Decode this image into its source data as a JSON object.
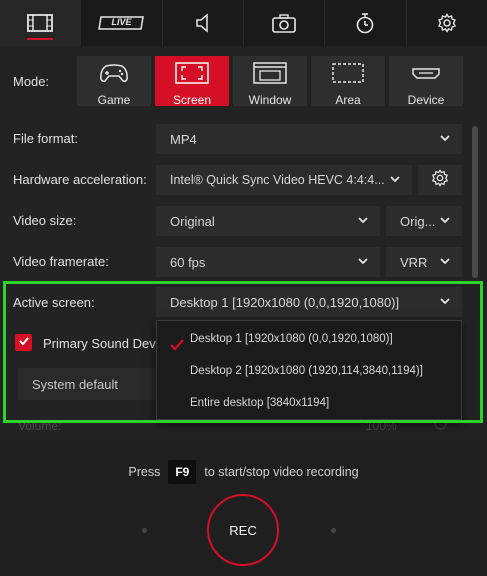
{
  "top_tabs": [
    {
      "icon": "film-icon",
      "active": true
    },
    {
      "icon": "live-icon",
      "label": "LIVE",
      "active": false
    },
    {
      "icon": "audio-icon",
      "active": false
    },
    {
      "icon": "camera-icon",
      "active": false
    },
    {
      "icon": "timer-icon",
      "active": false
    },
    {
      "icon": "gear-icon",
      "active": false
    }
  ],
  "mode": {
    "label": "Mode:",
    "options": [
      {
        "label": "Game",
        "icon": "gamepad-icon",
        "active": false
      },
      {
        "label": "Screen",
        "icon": "screen-icon",
        "active": true
      },
      {
        "label": "Window",
        "icon": "window-icon",
        "active": false
      },
      {
        "label": "Area",
        "icon": "area-icon",
        "active": false
      },
      {
        "label": "Device",
        "icon": "hdmi-icon",
        "active": false
      }
    ]
  },
  "settings": {
    "file_format": {
      "label": "File format:",
      "value": "MP4"
    },
    "hw_accel": {
      "label": "Hardware acceleration:",
      "value": "Intel® Quick Sync Video HEVC 4:4:4..."
    },
    "video_size": {
      "label": "Video size:",
      "value": "Original",
      "secondary": "Orig..."
    },
    "framerate": {
      "label": "Video framerate:",
      "value": "60 fps",
      "secondary": "VRR"
    },
    "active_screen": {
      "label": "Active screen:",
      "value": "Desktop 1 [1920x1080 (0,0,1920,1080)]"
    },
    "sound": {
      "label": "Primary Sound Dev",
      "checked": true
    },
    "system_default": "System default",
    "volume_label": "Volume:",
    "volume_value": "100%"
  },
  "dropdown": {
    "items": [
      {
        "label": "Desktop 1 [1920x1080 (0,0,1920,1080)]",
        "selected": true
      },
      {
        "label": "Desktop 2 [1920x1080 (1920,114,3840,1194)]",
        "selected": false
      },
      {
        "label": "Entire desktop [3840x1194]",
        "selected": false
      }
    ]
  },
  "bottom": {
    "hint_prefix": "Press",
    "hotkey": "F9",
    "hint_suffix": "to start/stop video recording",
    "rec_label": "REC"
  },
  "colors": {
    "accent": "#d50f25",
    "highlight": "#2bd42b",
    "background": "#1f1f1f"
  }
}
